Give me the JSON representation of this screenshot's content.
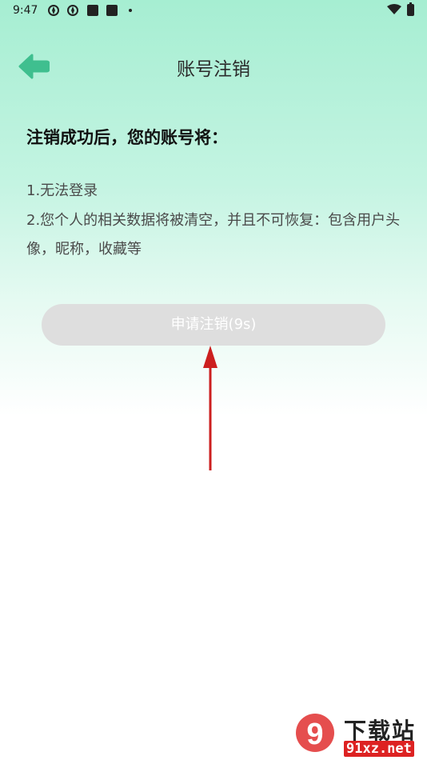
{
  "status_bar": {
    "time": "9:47",
    "icons": [
      "app-notification-icon",
      "app-notification-icon",
      "square-notification-icon",
      "square-notification-icon",
      "more-dot-icon",
      "wifi-icon",
      "battery-icon"
    ]
  },
  "header": {
    "title": "账号注销",
    "back_icon": "back-arrow-icon",
    "accent_color": "#3fbf8f"
  },
  "content": {
    "heading": "注销成功后，您的账号将：",
    "lines": [
      "1.无法登录",
      "2.您个人的相关数据将被清空，并且不可恢复：包含用户头像，昵称，收藏等"
    ]
  },
  "action": {
    "apply_label": "申请注销(9s)",
    "disabled": true,
    "button_color": "#dedede"
  },
  "annotation": {
    "arrow_color": "#cc1f1f"
  },
  "watermark": {
    "logo_glyph": "9",
    "text_top": "下载站",
    "text_bottom": "91xz.net"
  }
}
